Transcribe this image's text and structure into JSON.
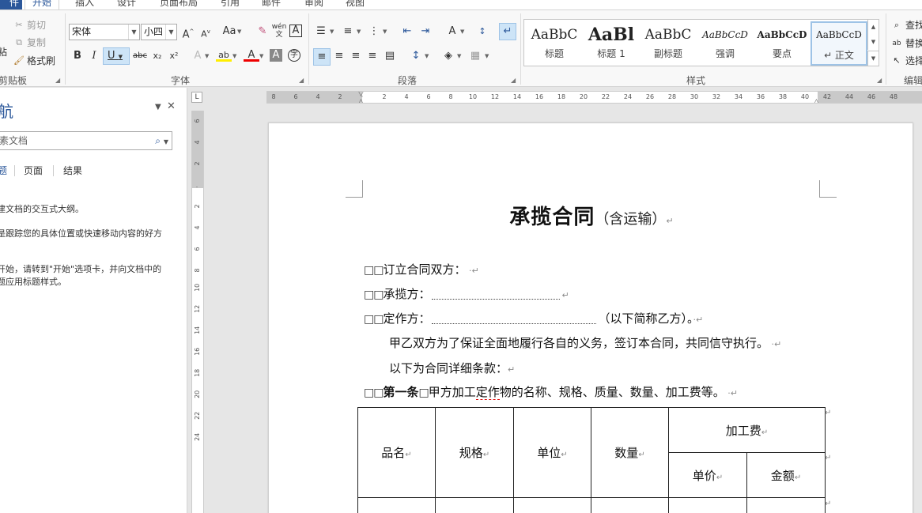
{
  "tabs": {
    "file": "件",
    "items": [
      "开始",
      "插入",
      "设计",
      "页面布局",
      "引用",
      "邮件",
      "审阅",
      "视图"
    ]
  },
  "clipboard": {
    "cut": "剪切",
    "copy": "复制",
    "format_painter": "格式刷",
    "paste_partial": "粘",
    "group": "剪贴板"
  },
  "font": {
    "name": "宋体",
    "size": "小四",
    "group": "字体",
    "case_label": "Aa",
    "phonetic": "wén 文",
    "border_char": "A"
  },
  "paragraph": {
    "group": "段落"
  },
  "styles": {
    "group": "样式",
    "items": [
      {
        "preview": "AaBbC",
        "name": "标题"
      },
      {
        "preview": "AaBl",
        "name": "标题 1"
      },
      {
        "preview": "AaBbC",
        "name": "副标题"
      },
      {
        "preview": "AaBbCcD",
        "name": "强调"
      },
      {
        "preview": "AaBbCcD",
        "name": "要点"
      },
      {
        "preview": "AaBbCcD",
        "name": "↵ 正文"
      }
    ]
  },
  "editing": {
    "find": "查找",
    "replace": "替换",
    "select": "选择",
    "group": "编辑"
  },
  "nav": {
    "title": "航",
    "search_placeholder": "素文档",
    "tabs": [
      "题",
      "页面",
      "结果"
    ],
    "line1": "建文档的交互式大纲。",
    "line2": "是跟踪您的具体位置或快速移动内容的好方",
    "line3": "开始，请转到\"开始\"选项卡，并向文档中的",
    "line4": "题应用标题样式。"
  },
  "ruler": {
    "h_ticks": [
      "8",
      "6",
      "4",
      "2",
      "",
      "2",
      "4",
      "6",
      "8",
      "10",
      "12",
      "14",
      "16",
      "18",
      "20",
      "22",
      "24",
      "26",
      "28",
      "30",
      "32",
      "34",
      "36",
      "38",
      "40",
      "42",
      "44",
      "46",
      "48"
    ],
    "v_ticks": [
      "6",
      "4",
      "2",
      "",
      "2",
      "4",
      "6",
      "8",
      "10",
      "12",
      "14",
      "16",
      "18",
      "20",
      "22",
      "24"
    ],
    "corner": "L"
  },
  "document": {
    "title": "承揽合同",
    "subtitle": "（含运输）",
    "pmark": "↵",
    "boxes": "□□",
    "line_parties": "订立合同双方：",
    "line_contractor": "承揽方：",
    "line_ordering": "定作方：",
    "line_ordering_suffix": "（以下简称乙方）。",
    "line_purpose": "甲乙双方为了保证全面地履行各自的义务，签订本合同，共同信守执行。",
    "line_intro": "以下为合同详细条款：",
    "article1_label": "第一条",
    "article1_box": "□",
    "article1_text_a": "甲方加工",
    "article1_text_b": "定作",
    "article1_text_c": "物的名称、规格、质量、数量、加工费等。",
    "table": {
      "headers": [
        "品名",
        "规格",
        "单位",
        "数量"
      ],
      "fee_header": "加工费",
      "fee_sub": [
        "单价",
        "金额"
      ]
    }
  }
}
